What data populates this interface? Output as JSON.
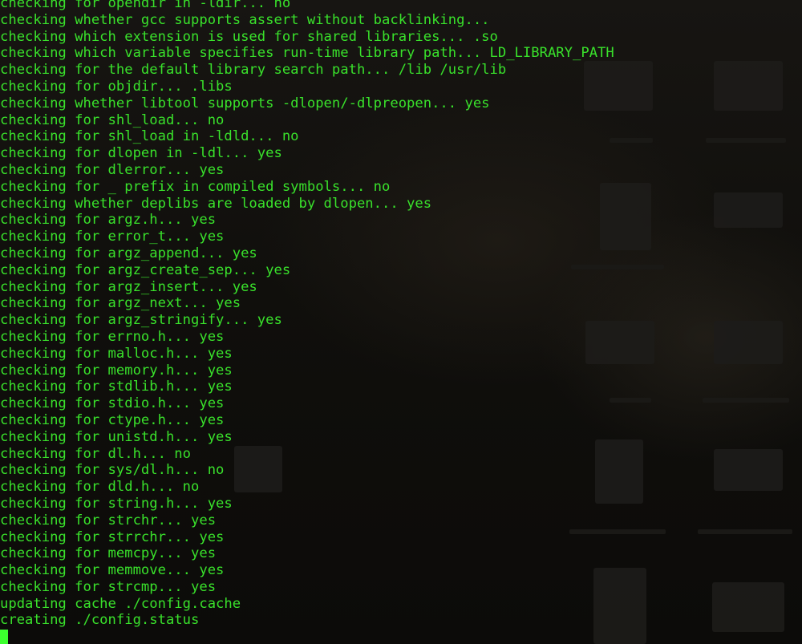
{
  "terminal": {
    "lines": [
      "checking for opendir in -ldir... no",
      "checking whether gcc supports assert without backlinking...",
      "checking which extension is used for shared libraries... .so",
      "checking which variable specifies run-time library path... LD_LIBRARY_PATH",
      "checking for the default library search path... /lib /usr/lib",
      "checking for objdir... .libs",
      "checking whether libtool supports -dlopen/-dlpreopen... yes",
      "checking for shl_load... no",
      "checking for shl_load in -ldld... no",
      "checking for dlopen in -ldl... yes",
      "checking for dlerror... yes",
      "checking for _ prefix in compiled symbols... no",
      "checking whether deplibs are loaded by dlopen... yes",
      "checking for argz.h... yes",
      "checking for error_t... yes",
      "checking for argz_append... yes",
      "checking for argz_create_sep... yes",
      "checking for argz_insert... yes",
      "checking for argz_next... yes",
      "checking for argz_stringify... yes",
      "checking for errno.h... yes",
      "checking for malloc.h... yes",
      "checking for memory.h... yes",
      "checking for stdlib.h... yes",
      "checking for stdio.h... yes",
      "checking for ctype.h... yes",
      "checking for unistd.h... yes",
      "checking for dl.h... no",
      "checking for sys/dl.h... no",
      "checking for dld.h... no",
      "checking for string.h... yes",
      "checking for strchr... yes",
      "checking for strrchr... yes",
      "checking for memcpy... yes",
      "checking for memmove... yes",
      "checking for strcmp... yes",
      "updating cache ./config.cache",
      "creating ./config.status"
    ],
    "text_color": "#39e12b",
    "cursor_color": "#3cff2e",
    "background_color": "#100f0c"
  }
}
